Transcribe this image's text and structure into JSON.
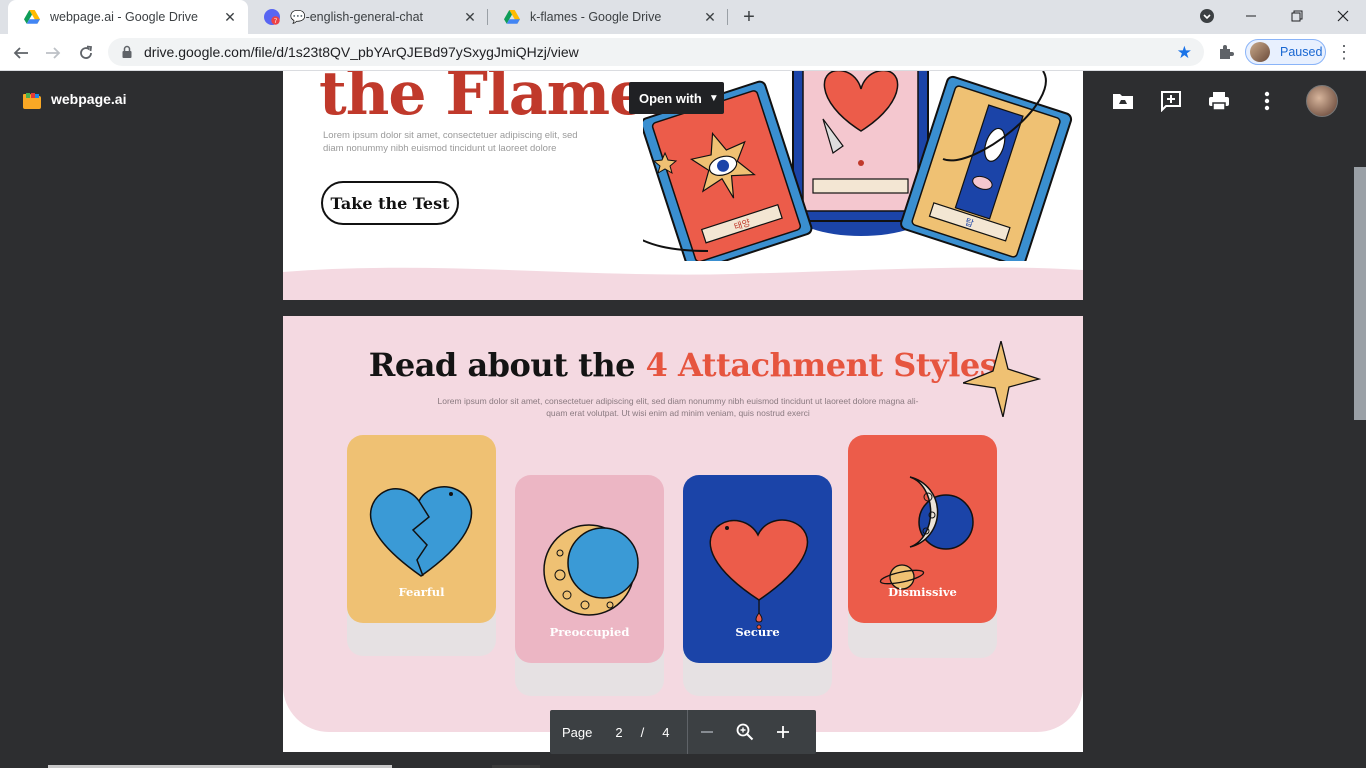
{
  "browser": {
    "tabs": [
      {
        "title": "webpage.ai - Google Drive",
        "active": true
      },
      {
        "title": "💬-english-general-chat",
        "active": false
      },
      {
        "title": "k-flames - Google Drive",
        "active": false
      }
    ],
    "url": "drive.google.com/file/d/1s23t8QV_pbYArQJEBd97ySxygJmiQHzj/view",
    "profile_label": "Paused",
    "accent_color": "#1a73e8"
  },
  "drive": {
    "file_name": "webpage.ai",
    "open_with_label": "Open with",
    "icons": [
      "add-to-drive-icon",
      "add-comment-icon",
      "print-icon",
      "more-vert-icon"
    ]
  },
  "page1": {
    "title": "the Flames",
    "lorem": "Lorem ipsum dolor sit amet, consectetuer adipiscing elit, sed diam nonummy nibh euismod tincidunt ut laoreet dolore",
    "cta": "Take the Test",
    "card_texts": [
      "태양",
      "탑"
    ]
  },
  "page2": {
    "title_prefix": "Read about the ",
    "title_accent": "4 Attachment Styles",
    "lorem": "Lorem ipsum dolor sit amet, consectetuer adipiscing elit, sed diam nonummy nibh euismod tincidunt ut laoreet dolore magna ali-quam erat volutpat. Ut wisi enim ad minim veniam, quis nostrud exerci",
    "cards": [
      {
        "label": "Fearful",
        "color": "#efc173"
      },
      {
        "label": "Preoccupied",
        "color": "#ecb6c4"
      },
      {
        "label": "Secure",
        "color": "#1b44a8"
      },
      {
        "label": "Dismissive",
        "color": "#ec5c4a"
      }
    ]
  },
  "pager": {
    "label": "Page",
    "current": "2",
    "separator": "/",
    "total": "4"
  }
}
